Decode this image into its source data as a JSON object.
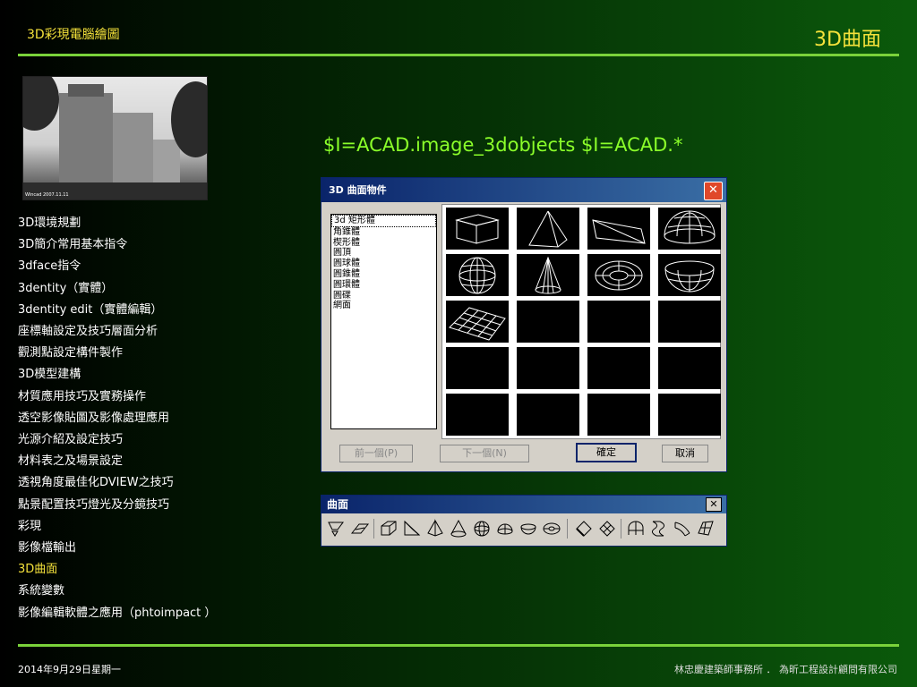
{
  "header": {
    "left_title": "3D彩現電腦繪圖",
    "right_title": "3D曲面"
  },
  "photo": {
    "caption": "Wincad 2007.11.11"
  },
  "nav": {
    "items": [
      "3D環境規劃",
      "3D簡介常用基本指令",
      "3dface指令",
      "3dentity（實體）",
      "3dentity edit（實體編輯）",
      "座標軸設定及技巧層面分析",
      "觀測點設定構件製作",
      "3D模型建構",
      "材質應用技巧及實務操作",
      "透空影像貼圖及影像處理應用",
      "光源介紹及設定技巧",
      "材料表之及場景設定",
      "透視角度最佳化DVIEW之技巧",
      "點景配置技巧燈光及分鏡技巧",
      "彩現",
      "影像檔輸出",
      "3D曲面",
      "系統變數",
      "影像編輯軟體之應用（phtoimpact ）"
    ],
    "active_index": 16
  },
  "command": "$I=ACAD.image_3dobjects $I=ACAD.*",
  "dialog": {
    "title": "3D 曲面物件",
    "list": [
      "3d 矩形體",
      "角錐體",
      "楔形體",
      "圓頂",
      "圓球體",
      "圓錐體",
      "圓環體",
      "圓碟",
      "網面"
    ],
    "selected": "3d 矩形體",
    "tiles": [
      "box",
      "pyramid",
      "wedge",
      "dome",
      "sphere",
      "cone",
      "torus",
      "dish",
      "mesh",
      "",
      "",
      "",
      "",
      "",
      "",
      "",
      "",
      "",
      "",
      ""
    ],
    "buttons": {
      "prev": "前一個(P)",
      "next": "下一個(N)",
      "ok": "確定",
      "cancel": "取消"
    }
  },
  "toolbar": {
    "title": "曲面",
    "close": "✕",
    "tools": [
      "2d-solid-icon",
      "3d-face-icon",
      "box-icon",
      "wedge-icon",
      "pyramid-icon",
      "cone-icon",
      "sphere-icon",
      "dome-icon",
      "dish-icon",
      "torus-icon",
      "edge-icon",
      "3d-mesh-icon",
      "revolved-surface-icon",
      "tabulated-surface-icon",
      "ruled-surface-icon",
      "edge-surface-icon"
    ]
  },
  "footer": {
    "date": "2014年9月29日星期一",
    "org": "林忠慶建築師事務所 ． 為昕工程設計顧問有限公司"
  },
  "colors": {
    "accent": "#f5e23b",
    "rule": "#7ad23a",
    "command": "#8bff2a"
  }
}
